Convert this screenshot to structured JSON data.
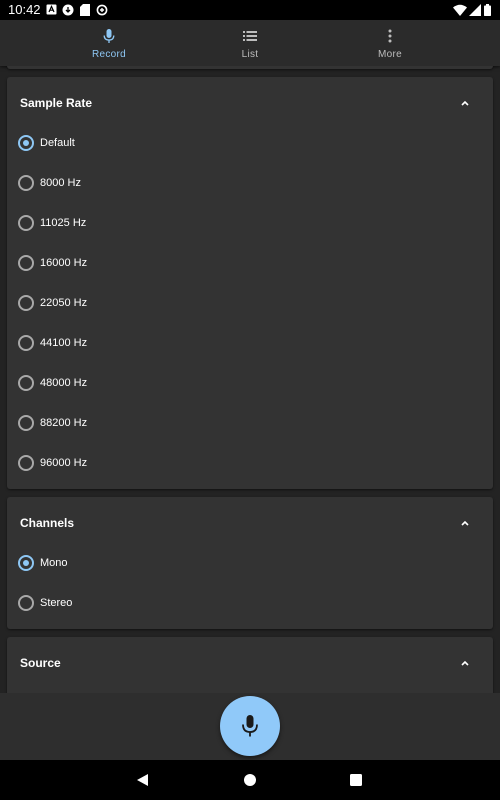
{
  "status_bar": {
    "time": "10:42",
    "left_icons": [
      "text-notification-icon",
      "cloud-download-icon",
      "sd-card-icon",
      "data-saver-icon"
    ],
    "right_icons": [
      "wifi-icon",
      "cellular-signal-icon",
      "battery-icon"
    ]
  },
  "top_nav": {
    "tabs": [
      {
        "label": "Record",
        "icon": "microphone-icon",
        "active": true
      },
      {
        "label": "List",
        "icon": "list-icon",
        "active": false
      },
      {
        "label": "More",
        "icon": "more-vertical-icon",
        "active": false
      }
    ]
  },
  "sample_rate": {
    "title": "Sample Rate",
    "options": [
      "Default",
      "8000 Hz",
      "11025 Hz",
      "16000 Hz",
      "22050 Hz",
      "44100 Hz",
      "48000 Hz",
      "88200 Hz",
      "96000 Hz"
    ],
    "selected": "Default"
  },
  "channels": {
    "title": "Channels",
    "options": [
      "Mono",
      "Stereo"
    ],
    "selected": "Mono"
  },
  "source": {
    "title": "Source"
  },
  "record_button": {
    "icon": "microphone-icon"
  },
  "colors": {
    "accent": "#8ec7f4",
    "fab": "#90c9f9",
    "card_background": "#333333",
    "page_background": "#232323"
  }
}
